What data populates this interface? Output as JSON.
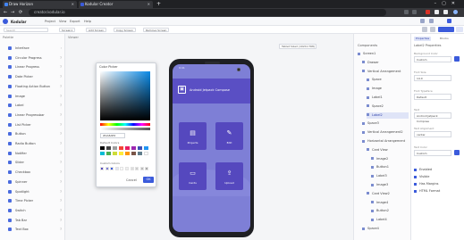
{
  "browser": {
    "tabs": [
      {
        "label": "Draw Horizon"
      },
      {
        "label": "Kodular Creator"
      }
    ],
    "new_tab": "+",
    "window_controls": "–▢✕",
    "back": "←",
    "forward": "→",
    "reload": "⟳",
    "url": "creator.kodular.io"
  },
  "app": {
    "title": "Kodular",
    "menu": [
      "Project",
      "View",
      "Export",
      "Help"
    ],
    "search_placeholder": "Search",
    "toolbar_chips": [
      "Screen1",
      "Add Screen",
      "Copy Screen",
      "Remove Screen"
    ]
  },
  "sidebar": {
    "header": "Palette",
    "items": [
      {
        "label": "Interface",
        "count": "›"
      },
      {
        "label": "Circular Progress",
        "count": "?"
      },
      {
        "label": "Linear Progress",
        "count": "?"
      },
      {
        "label": "Date Picker",
        "count": "?"
      },
      {
        "label": "Floating Action Button",
        "count": "?"
      },
      {
        "label": "Image",
        "count": "?"
      },
      {
        "label": "Label",
        "count": "?"
      },
      {
        "label": "Linear Progressbar",
        "count": "?"
      },
      {
        "label": "List Picker",
        "count": "?"
      },
      {
        "label": "Button",
        "count": "?"
      },
      {
        "label": "Radio Button",
        "count": "?"
      },
      {
        "label": "Notifier",
        "count": "?"
      },
      {
        "label": "Slider",
        "count": "?"
      },
      {
        "label": "Checkbox",
        "count": "?"
      },
      {
        "label": "Spinner",
        "count": "?"
      },
      {
        "label": "Spotlight",
        "count": "?"
      },
      {
        "label": "Time Picker",
        "count": "?"
      },
      {
        "label": "Switch",
        "count": "?"
      },
      {
        "label": "Tab Bar",
        "count": "?"
      },
      {
        "label": "Text Box",
        "count": "?"
      }
    ]
  },
  "canvas": {
    "header": "Viewer",
    "device": "Tablet Sized (1024×768)",
    "phone": {
      "status": "9:41",
      "hero_icon": "▣",
      "hero_title": "Android Jetpack Compose",
      "cards": [
        {
          "icon": "▤",
          "label": "Projects"
        },
        {
          "icon": "✎",
          "label": "Edit"
        },
        {
          "icon": "▭",
          "label": "Cards"
        },
        {
          "icon": "⇪",
          "label": "Upload"
        }
      ]
    }
  },
  "color_picker": {
    "title": "Color Picker",
    "hex_value": "#0A8AE6",
    "recent_label": "Default Colors",
    "custom_label": "Custom Colors",
    "cancel": "Cancel",
    "ok": "OK",
    "swatch_colors": [
      "#000000",
      "#424242",
      "#9e9e9e",
      "#f44336",
      "#e91e63",
      "#9c27b0",
      "#3f51b5",
      "#2196f3",
      "#00bcd4",
      "#4caf50",
      "#cddc39",
      "#ffeb3b",
      "#ff9800",
      "#795548",
      "#607d8b",
      "#ffffff"
    ],
    "custom_colors": [
      "#5548be",
      "#7e7fd6",
      "#3b5bdb",
      "#dfe4f7",
      "#ffffff",
      "#eeeeee",
      "#dddddd",
      "#cccccc",
      "#bbbbbb",
      "#aaaaaa"
    ]
  },
  "tree": {
    "header": "Components",
    "items": [
      {
        "label": "Screen1",
        "indent": 0,
        "selected": false
      },
      {
        "label": "Drawer",
        "indent": 1,
        "selected": false
      },
      {
        "label": "Vertical Arrangement",
        "indent": 1,
        "selected": false
      },
      {
        "label": "Space",
        "indent": 2,
        "selected": false
      },
      {
        "label": "Image",
        "indent": 2,
        "selected": false
      },
      {
        "label": "Label1",
        "indent": 2,
        "selected": false
      },
      {
        "label": "Space2",
        "indent": 2,
        "selected": false
      },
      {
        "label": "Label2",
        "indent": 2,
        "selected": true
      },
      {
        "label": "Space3",
        "indent": 1,
        "selected": false
      },
      {
        "label": "Vertical Arrangement2",
        "indent": 1,
        "selected": false
      },
      {
        "label": "Horizontal Arrangement",
        "indent": 1,
        "selected": false
      },
      {
        "label": "Card View",
        "indent": 2,
        "selected": false
      },
      {
        "label": "Image2",
        "indent": 3,
        "selected": false
      },
      {
        "label": "Button1",
        "indent": 3,
        "selected": false
      },
      {
        "label": "Label3",
        "indent": 3,
        "selected": false
      },
      {
        "label": "Image3",
        "indent": 3,
        "selected": false
      },
      {
        "label": "Card View2",
        "indent": 2,
        "selected": false
      },
      {
        "label": "Image4",
        "indent": 3,
        "selected": false
      },
      {
        "label": "Button2",
        "indent": 3,
        "selected": false
      },
      {
        "label": "Label4",
        "indent": 3,
        "selected": false
      },
      {
        "label": "Space4",
        "indent": 1,
        "selected": false
      }
    ]
  },
  "props": {
    "header": "Label2 Properties",
    "tabs": [
      "Properties",
      "Blocks"
    ],
    "fields": [
      {
        "label": "Background Color",
        "value": "Custom"
      },
      {
        "label": "Font Size",
        "value": "14.0"
      },
      {
        "label": "Font Typeface",
        "value": "Default"
      },
      {
        "label": "Text",
        "value": "Android Jetpack Compose"
      },
      {
        "label": "Text Alignment",
        "value": "center"
      },
      {
        "label": "Text Color",
        "value": "Custom"
      }
    ],
    "checks": [
      "Enabled",
      "Visible",
      "Has Margins",
      "HTML Format"
    ]
  },
  "colors": {
    "accent": "#3b5bdb",
    "phone_bg": "#7e7fd6",
    "card": "#5548be"
  }
}
